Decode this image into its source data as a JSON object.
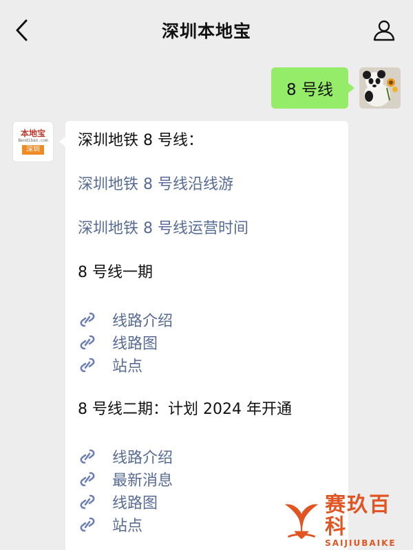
{
  "header": {
    "title": "深圳本地宝",
    "back_icon": "chevron-left-icon",
    "profile_icon": "person-icon"
  },
  "outgoing": {
    "text": "8 号线"
  },
  "incoming": {
    "sender_logo": {
      "top": "本地宝",
      "domain": "Bendibao.com",
      "tag": "深圳"
    },
    "heading": "深圳地铁 8 号线：",
    "links": [
      "深圳地铁 8 号线沿线游",
      "深圳地铁 8 号线运营时间"
    ],
    "section1": {
      "title": "8 号线一期",
      "items": [
        "线路介绍",
        "线路图",
        "站点"
      ]
    },
    "section2": {
      "title": "8 号线二期：计划 2024 年开通",
      "items": [
        "线路介绍",
        "最新消息",
        "线路图",
        "站点"
      ]
    }
  },
  "watermark": {
    "cn": "赛玖百科",
    "en": "SAIJIUBAIKE"
  },
  "colors": {
    "background": "#ededed",
    "outgoing_bubble": "#95ec69",
    "link": "#576b95",
    "watermark": "#e05522"
  }
}
